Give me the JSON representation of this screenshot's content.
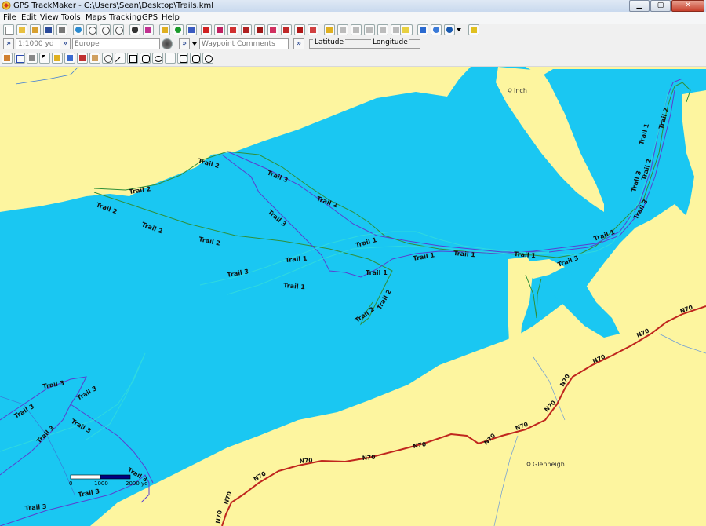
{
  "window": {
    "title": "GPS TrackMaker - C:\\Users\\Sean\\Desktop\\Trails.kml",
    "min_glyph": "▁",
    "max_glyph": "▢",
    "close_glyph": "✕"
  },
  "menu": [
    "File",
    "Edit",
    "View",
    "Tools",
    "Maps",
    "Tracking",
    "GPS",
    "Help"
  ],
  "toolbar2": {
    "scale_value": "1:1000 yd",
    "region_value": "Europe",
    "comment_placeholder": "Waypoint Comments",
    "arrow_glyph": "»",
    "latitude_label": "Latitude",
    "longitude_label": "Longitude"
  },
  "map": {
    "colors": {
      "sea": "#1ac7f2",
      "land": "#fdf59f",
      "road": "#c0261e",
      "trail1": "#2fd8e0",
      "trail2": "#2f8f3a",
      "trail3": "#5a3fd0"
    },
    "places": [
      {
        "id": "inch",
        "name": "Inch"
      },
      {
        "id": "glenbeigh",
        "name": "Glenbeigh"
      }
    ],
    "road_name": "N70",
    "trail_labels": {
      "t1": "Trail 1",
      "t2": "Trail 2",
      "t3": "Trail 3"
    },
    "scalebar": {
      "ticks": [
        "0",
        "1000",
        "2000 yd"
      ]
    }
  }
}
